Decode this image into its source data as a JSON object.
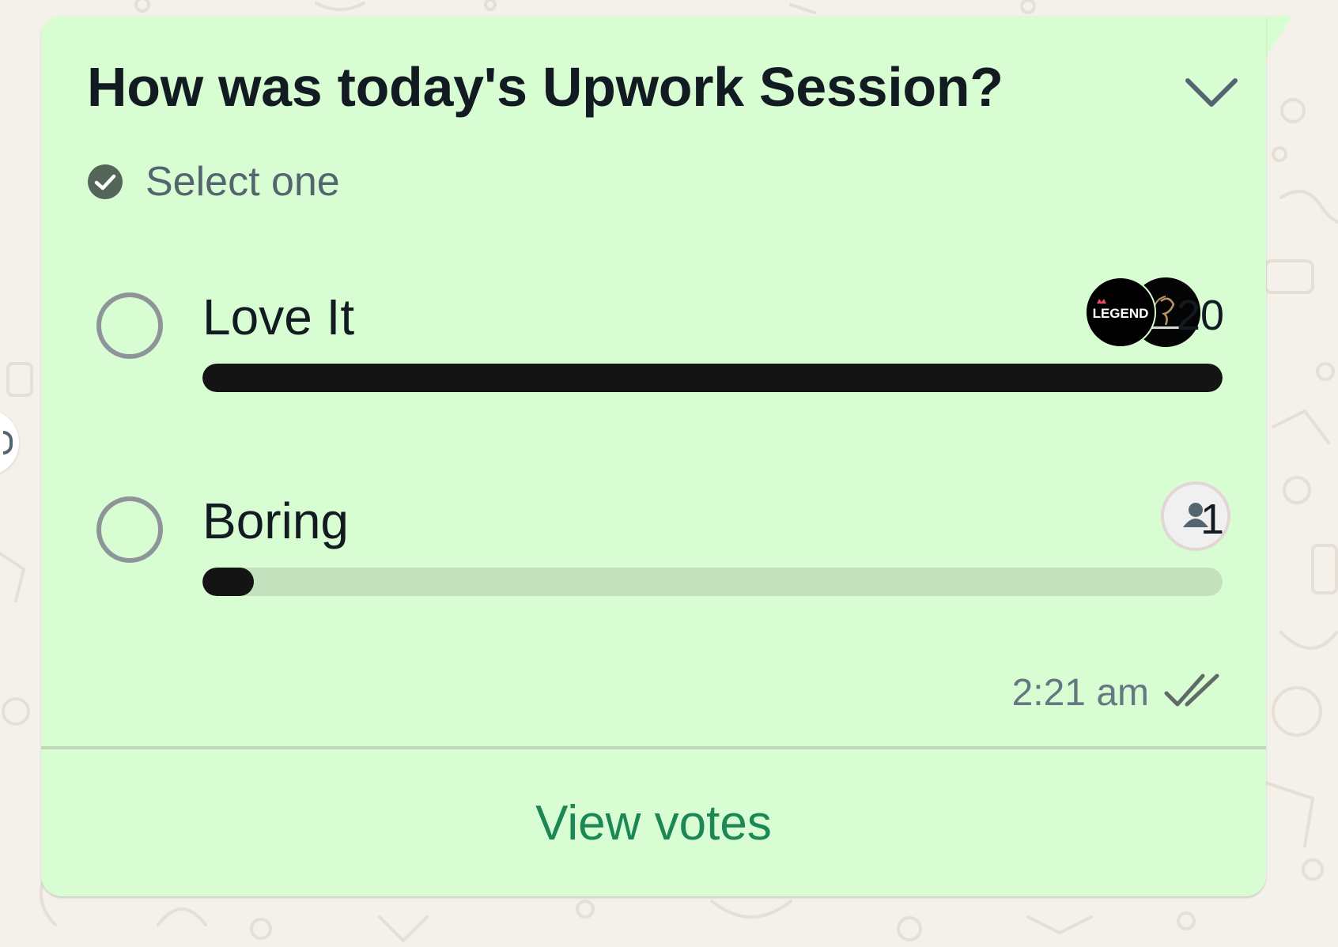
{
  "poll": {
    "question": "How was today's Upwork Session?",
    "instruction": "Select one",
    "options": [
      {
        "label": "Love It",
        "count": "20",
        "fraction": 1.0,
        "voter_avatars": [
          "legend-logo-avatar",
          "enterprises-logo-avatar"
        ],
        "avatar_text": "LEGEND"
      },
      {
        "label": "Boring",
        "count": "1",
        "fraction": 0.05,
        "voter_avatars": [
          "default-user-avatar"
        ]
      }
    ],
    "timestamp": "2:21 am",
    "status_icon": "double-check-icon",
    "view_votes_label": "View votes"
  },
  "colors": {
    "bubble": "#d9fdd3",
    "bar_fill": "#141414",
    "bar_track": "#c4e1bd",
    "link": "#1a8754",
    "muted_text": "#667781"
  }
}
